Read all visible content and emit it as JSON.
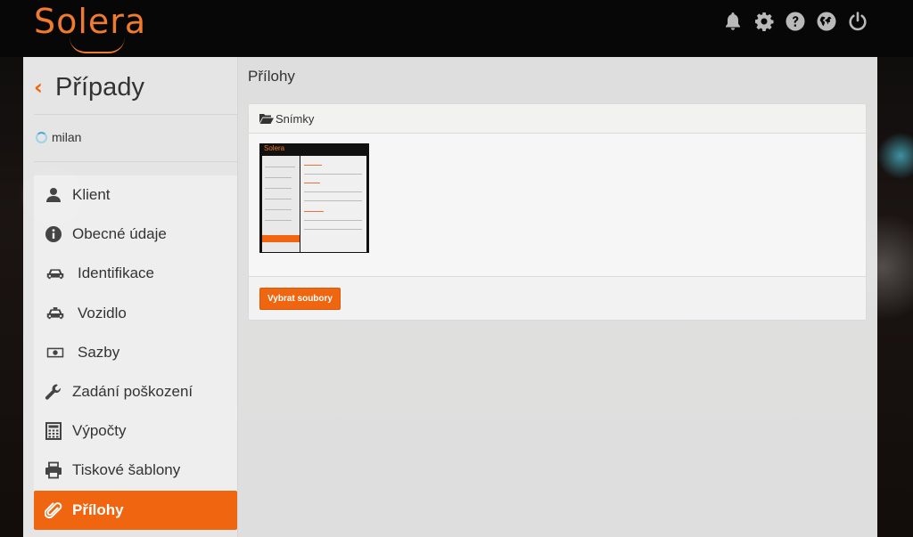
{
  "header": {
    "logo_text": "Solera",
    "icons": [
      "bell-icon",
      "gear-icon",
      "help-icon",
      "globe-icon",
      "power-icon"
    ]
  },
  "sidebar": {
    "back_title": "Případy",
    "user": "milan",
    "items": [
      {
        "label": "Klient",
        "icon": "user-icon"
      },
      {
        "label": "Obecné údaje",
        "icon": "info-icon"
      },
      {
        "label": "Identifikace",
        "icon": "car-icon"
      },
      {
        "label": "Vozidlo",
        "icon": "taxi-icon"
      },
      {
        "label": "Sazby",
        "icon": "money-icon"
      },
      {
        "label": "Zadání poškození",
        "icon": "wrench-icon"
      },
      {
        "label": "Výpočty",
        "icon": "calculator-icon"
      },
      {
        "label": "Tiskové šablony",
        "icon": "print-icon"
      },
      {
        "label": "Přílohy",
        "icon": "paperclip-icon",
        "active": true
      }
    ]
  },
  "main": {
    "title": "Přílohy",
    "card": {
      "header": "Snímky",
      "button": "Vybrat soubory",
      "thumbnail_logo": "Solera"
    }
  },
  "colors": {
    "accent": "#f0650f",
    "logo": "#f07a2e"
  }
}
